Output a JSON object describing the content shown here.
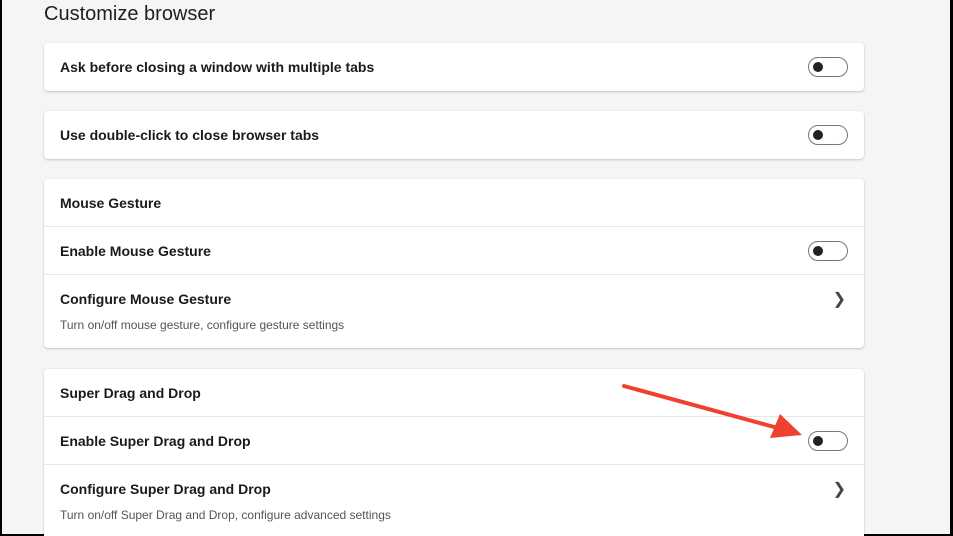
{
  "page_title": "Customize browser",
  "settings": {
    "ask_close": {
      "label": "Ask before closing a window with multiple tabs",
      "enabled": false
    },
    "dblclick": {
      "label": "Use double-click to close browser tabs",
      "enabled": false
    },
    "mouse_gesture": {
      "header": "Mouse Gesture",
      "enable_label": "Enable Mouse Gesture",
      "enabled": false,
      "configure_label": "Configure Mouse Gesture",
      "configure_desc": "Turn on/off mouse gesture, configure gesture settings"
    },
    "super_drag": {
      "header": "Super Drag and Drop",
      "enable_label": "Enable Super Drag and Drop",
      "enabled": false,
      "configure_label": "Configure Super Drag and Drop",
      "configure_desc": "Turn on/off Super Drag and Drop, configure advanced settings"
    }
  },
  "annotation_color": "#f04030"
}
